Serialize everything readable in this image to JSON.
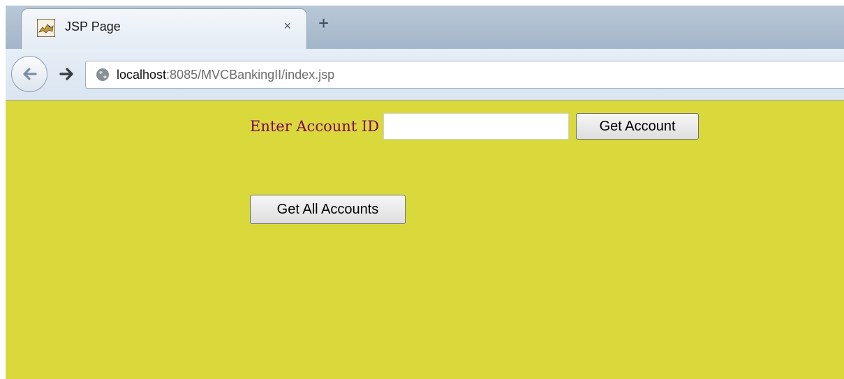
{
  "browser": {
    "tab": {
      "title": "JSP Page",
      "favicon": "tomcat-icon",
      "close_glyph": "×"
    },
    "new_tab_glyph": "+",
    "nav": {
      "back_icon": "back-arrow-icon",
      "forward_icon": "forward-arrow-icon",
      "site_icon": "globe-icon"
    },
    "url": {
      "host": "localhost",
      "rest": ":8085/MVCBankingII/index.jsp"
    }
  },
  "page": {
    "background": "#d9d93b",
    "label_color": "#800060",
    "account_label": "Enter Account ID",
    "account_input_value": "",
    "get_account_label": "Get Account",
    "get_all_label": "Get All Accounts"
  }
}
